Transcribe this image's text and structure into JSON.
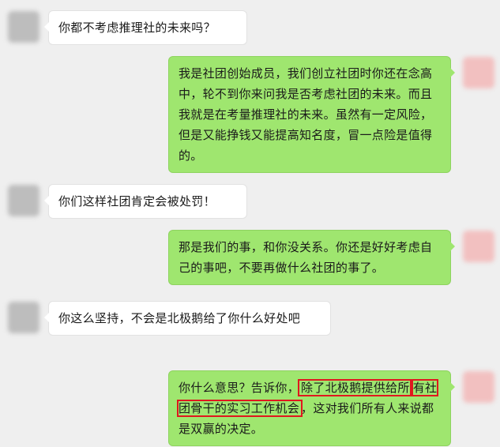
{
  "messages": [
    {
      "side": "left",
      "text": "你都不考虑推理社的未来吗？"
    },
    {
      "side": "right",
      "text": "我是社团创始成员，我们创立社团时你还在念高中，轮不到你来问我是否考虑社团的未来。而且我就是在考量推理社的未来。虽然有一定风险，但是又能挣钱又能提高知名度，冒一点险是值得的。"
    },
    {
      "side": "left",
      "text": "你们这样社团肯定会被处罚！"
    },
    {
      "side": "right",
      "text": "那是我们的事，和你没关系。你还是好好考虑自己的事吧，不要再做什么社团的事了。"
    },
    {
      "side": "left",
      "text": "你这么坚持，不会是北极鹅给了你什么好处吧"
    },
    {
      "side": "right",
      "text_before": "你什么意思？告诉你，",
      "highlight_1": "除了北极鹅提供给所",
      "highlight_2": "有社团骨干的实习工作机会",
      "text_after": "，这对我们所有人来说都是双赢的决定。"
    }
  ],
  "colors": {
    "background": "#efefef",
    "sent_bubble": "#9fe66f",
    "received_bubble": "#ffffff",
    "highlight_box": "#e0181e"
  }
}
